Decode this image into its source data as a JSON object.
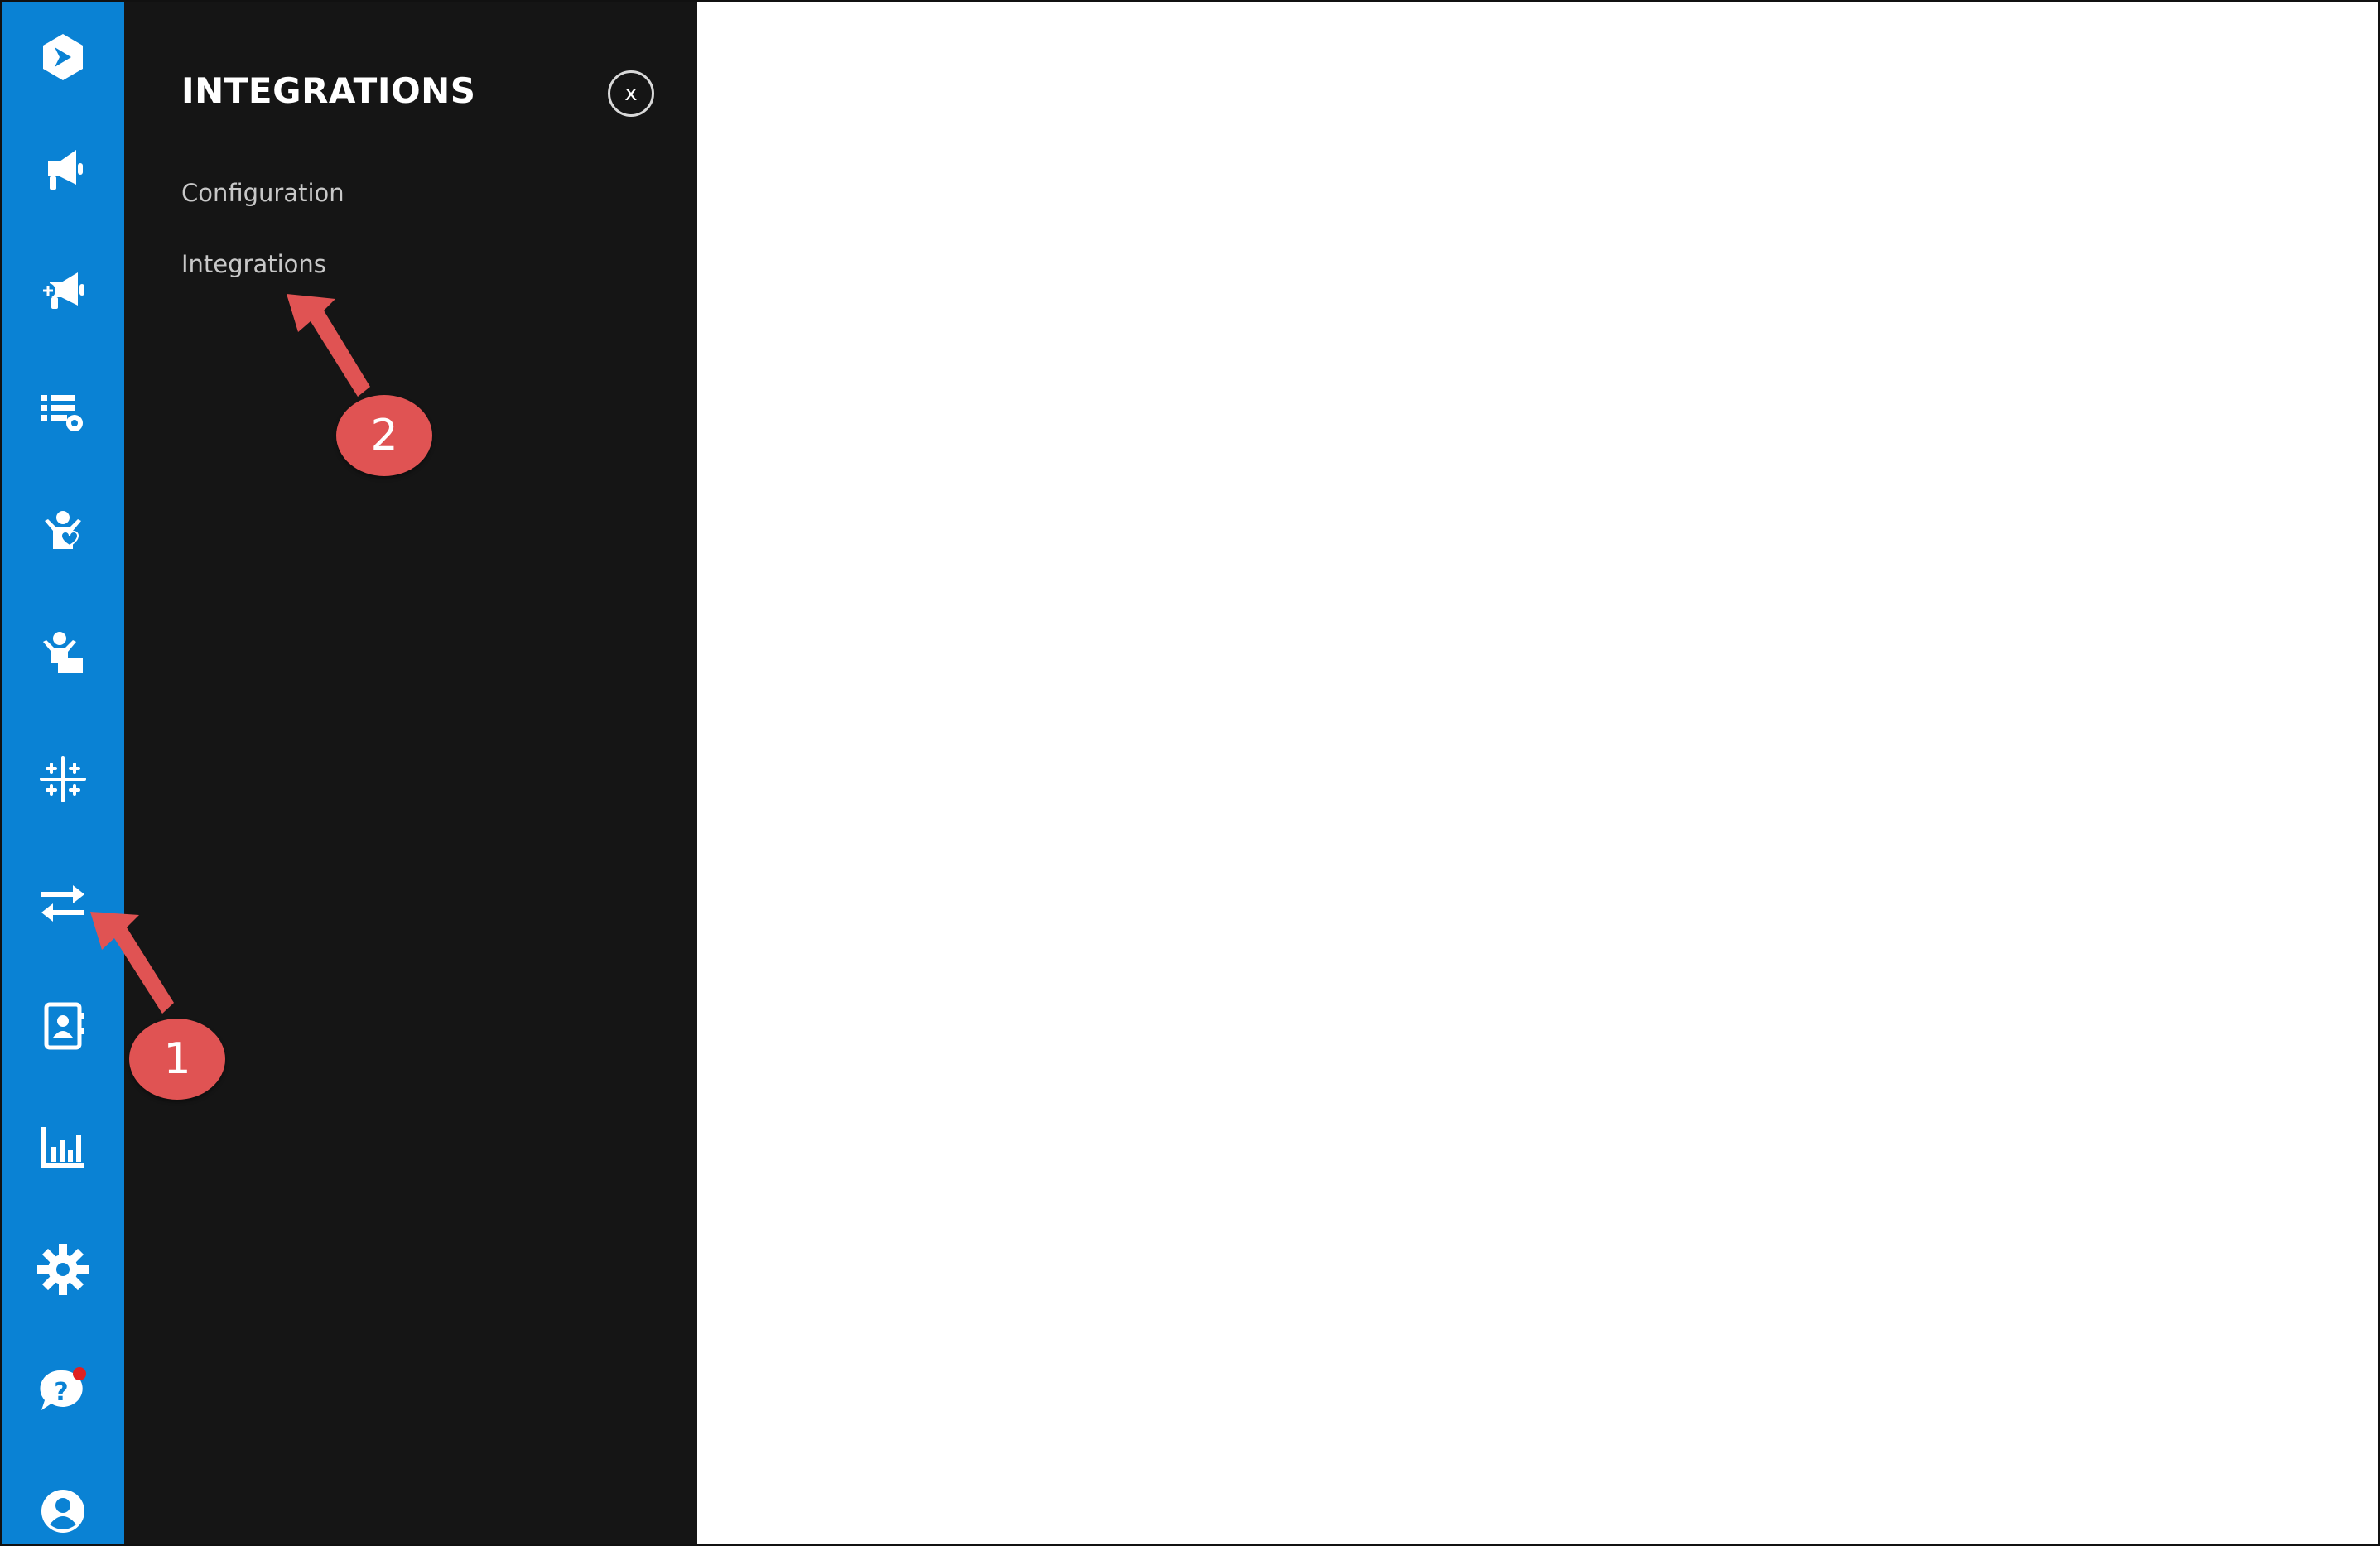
{
  "panel": {
    "title": "INTEGRATIONS",
    "close_label": "x",
    "items": [
      {
        "label": "Configuration"
      },
      {
        "label": "Integrations"
      }
    ]
  },
  "sidebar": {
    "items": [
      {
        "icon": "logo-icon"
      },
      {
        "icon": "megaphone-icon"
      },
      {
        "icon": "megaphone-add-icon"
      },
      {
        "icon": "list-settings-icon"
      },
      {
        "icon": "volunteer-heart-icon"
      },
      {
        "icon": "person-desk-icon"
      },
      {
        "icon": "sparkle-grid-icon"
      },
      {
        "icon": "transfer-arrows-icon",
        "active": true
      },
      {
        "icon": "contact-book-icon"
      },
      {
        "icon": "bar-chart-icon"
      },
      {
        "icon": "gear-icon"
      },
      {
        "icon": "help-chat-icon",
        "notification": true
      },
      {
        "icon": "user-avatar-icon"
      }
    ]
  },
  "annotations": [
    {
      "label": "1"
    },
    {
      "label": "2"
    }
  ],
  "colors": {
    "sidebar": "#0a82d4",
    "panel": "#151515",
    "annotation": "#e05353"
  }
}
